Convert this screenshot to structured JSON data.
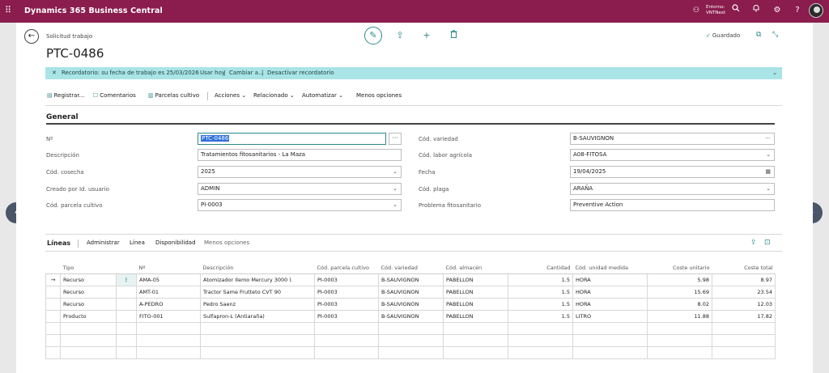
{
  "topbar": {
    "waffle_icon": "app-launcher-icon",
    "app_name": "Dynamics 365 Business Central",
    "env_label_1": "Entorno:",
    "env_label_2": "VNTNext",
    "icons": [
      "environment-icon",
      "search-icon",
      "bell-icon",
      "gear-icon",
      "help-icon",
      "avatar"
    ],
    "color": "#8a1d4d"
  },
  "header": {
    "breadcrumb": "Solicitud trabajo",
    "title": "PTC-0486",
    "saved": "Guardado"
  },
  "banner": {
    "message": "Recordatorio: su fecha de trabajo es 25/03/2026",
    "links": [
      "Usar hoy",
      "Cambiar a...",
      "Desactivar recordatorio"
    ],
    "color": "#a9e4e6"
  },
  "actionbar": {
    "items": [
      "Registrar...",
      "Comentarios",
      "Parcelas cultivo",
      "Acciones",
      "Relacionado",
      "Automatizar",
      "Menos opciones"
    ]
  },
  "general": {
    "title": "General",
    "left": [
      {
        "label": "Nº",
        "value": "PTC-0486"
      },
      {
        "label": "Descripción",
        "value": "Tratamientos fitosanitarios - La Maza"
      },
      {
        "label": "Cód. cosecha",
        "value": "2025"
      },
      {
        "label": "Creado por Id. usuario",
        "value": "ADMIN"
      },
      {
        "label": "Cód. parcela cultivo",
        "value": "PI-0003"
      }
    ],
    "right": [
      {
        "label": "Cód. variedad",
        "value": "B-SAUVIGNON"
      },
      {
        "label": "Cód. labor agrícola",
        "value": "A08-FITOSA"
      },
      {
        "label": "Fecha",
        "value": "19/04/2025"
      },
      {
        "label": "Cód. plaga",
        "value": "ARAÑA"
      },
      {
        "label": "Problema fitosanitario",
        "value": "Preventive Action"
      }
    ],
    "more_glyph": "···"
  },
  "lines": {
    "title": "Líneas",
    "actions": [
      "Administrar",
      "Línea",
      "Disponibilidad",
      "Menos opciones"
    ],
    "columns": [
      "Tipo",
      "Nº",
      "Descripción",
      "Cód. parcela cultivo",
      "Cód. variedad",
      "Cód. almacén",
      "Cantidad",
      "Cód. unidad medida",
      "Coste unitario",
      "Coste total"
    ],
    "rows": [
      [
        "Recurso",
        "AMA-05",
        "Atomizador Ilemo Mercury 3000 l.",
        "PI-0003",
        "B-SAUVIGNON",
        "PABELLON",
        "1.5",
        "HORA",
        "5.98",
        "8.97"
      ],
      [
        "Recurso",
        "AMT-01",
        "Tractor Same Frutteto CVT 90",
        "PI-0003",
        "B-SAUVIGNON",
        "PABELLON",
        "1.5",
        "HORA",
        "15.69",
        "23.54"
      ],
      [
        "Recurso",
        "A-PEDRO",
        "Pedro Saenz",
        "PI-0003",
        "B-SAUVIGNON",
        "PABELLON",
        "1.5",
        "HORA",
        "8.02",
        "12.03"
      ],
      [
        "Producto",
        "FITO-001",
        "Sulfapron-L (Antiaraña)",
        "PI-0003",
        "B-SAUVIGNON",
        "PABELLON",
        "1.5",
        "LITRO",
        "11.88",
        "17.82"
      ]
    ],
    "row_marker": "→",
    "dots_glyph": "⋮"
  },
  "colors": {
    "accent": "#2d8a8a",
    "brand": "#8a1d4d"
  }
}
